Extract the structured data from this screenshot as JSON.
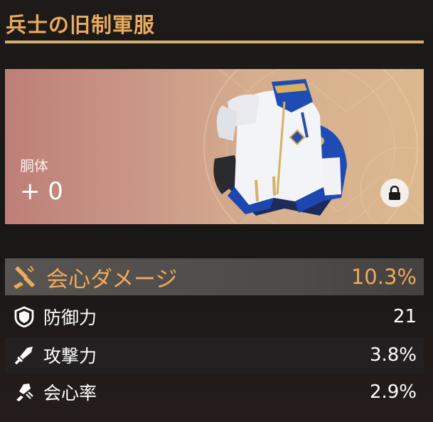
{
  "artifact": {
    "title": "兵士の旧制軍服",
    "slot": "胴体",
    "level": "+ 0",
    "locked": true
  },
  "main_stat": {
    "name": "会心ダメージ",
    "value": "10.3%",
    "icon": "crit-damage-icon",
    "color": "#eeaa5c"
  },
  "sub_stats": [
    {
      "name": "防御力",
      "value": "21",
      "icon": "shield-icon"
    },
    {
      "name": "攻撃力",
      "value": "3.8%",
      "icon": "sword-icon"
    },
    {
      "name": "会心率",
      "value": "2.9%",
      "icon": "crit-rate-icon"
    }
  ],
  "colors": {
    "title": "#e8aa5c",
    "rule": "#d6ae72",
    "card_left": "#bd7f78",
    "card_right": "#dcb88e"
  }
}
